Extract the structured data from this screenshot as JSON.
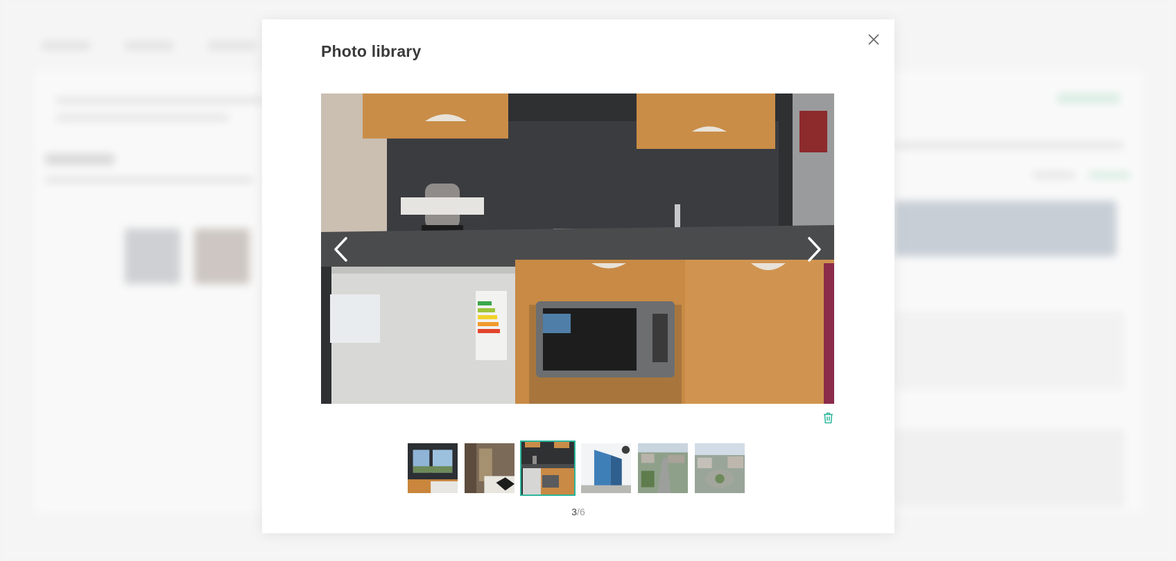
{
  "modal": {
    "title": "Photo library",
    "close_icon": "close-icon",
    "prev_icon": "chevron-left-icon",
    "next_icon": "chevron-right-icon",
    "delete_icon": "trash-icon",
    "accent_color": "#2bb59a",
    "current_photo_description": "kitchenette",
    "thumbnails": [
      {
        "subject": "window-view"
      },
      {
        "subject": "bedroom"
      },
      {
        "subject": "kitchenette",
        "active": true
      },
      {
        "subject": "building-exterior"
      },
      {
        "subject": "aerial-city-view"
      },
      {
        "subject": "aerial-plaza-view"
      }
    ],
    "counter": {
      "current": "3",
      "separator": "/",
      "total": "6"
    }
  }
}
